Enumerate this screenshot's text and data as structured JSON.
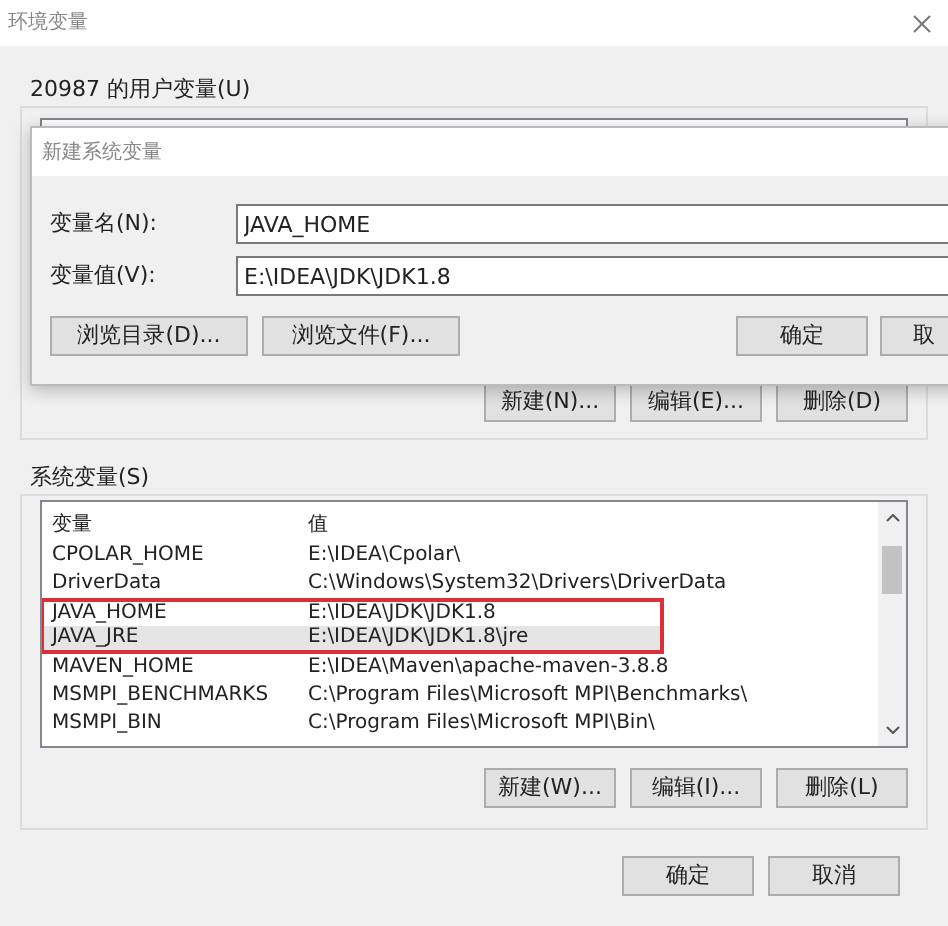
{
  "window": {
    "title": "环境变量"
  },
  "user_variables": {
    "label": "20987 的用户变量(U)",
    "buttons": [
      "新建(N)...",
      "编辑(E)...",
      "删除(D)"
    ]
  },
  "dialog": {
    "title": "新建系统变量",
    "fields": [
      {
        "label": "变量名(N):",
        "value": "JAVA_HOME"
      },
      {
        "label": "变量值(V):",
        "value": "E:\\IDEA\\JDK\\JDK1.8"
      }
    ],
    "left_buttons": [
      "浏览目录(D)...",
      "浏览文件(F)..."
    ],
    "right_buttons": [
      "确定",
      "取"
    ]
  },
  "system_variables": {
    "label": "系统变量(S)",
    "columns": [
      "变量",
      "值"
    ],
    "rows": [
      {
        "name": "CPOLAR_HOME",
        "value": "E:\\IDEA\\Cpolar\\",
        "selected": false,
        "highlighted": false
      },
      {
        "name": "DriverData",
        "value": "C:\\Windows\\System32\\Drivers\\DriverData",
        "selected": false,
        "highlighted": false
      },
      {
        "name": "JAVA_HOME",
        "value": "E:\\IDEA\\JDK\\JDK1.8",
        "selected": false,
        "highlighted": true
      },
      {
        "name": "JAVA_JRE",
        "value": "E:\\IDEA\\JDK\\JDK1.8\\jre",
        "selected": true,
        "highlighted": true
      },
      {
        "name": "MAVEN_HOME",
        "value": "E:\\IDEA\\Maven\\apache-maven-3.8.8",
        "selected": false,
        "highlighted": false
      },
      {
        "name": "MSMPI_BENCHMARKS",
        "value": "C:\\Program Files\\Microsoft MPI\\Benchmarks\\",
        "selected": false,
        "highlighted": false
      },
      {
        "name": "MSMPI_BIN",
        "value": "C:\\Program Files\\Microsoft MPI\\Bin\\",
        "selected": false,
        "highlighted": false
      }
    ],
    "buttons": [
      "新建(W)...",
      "编辑(I)...",
      "删除(L)"
    ]
  },
  "buttons": [
    "确定",
    "取消"
  ]
}
